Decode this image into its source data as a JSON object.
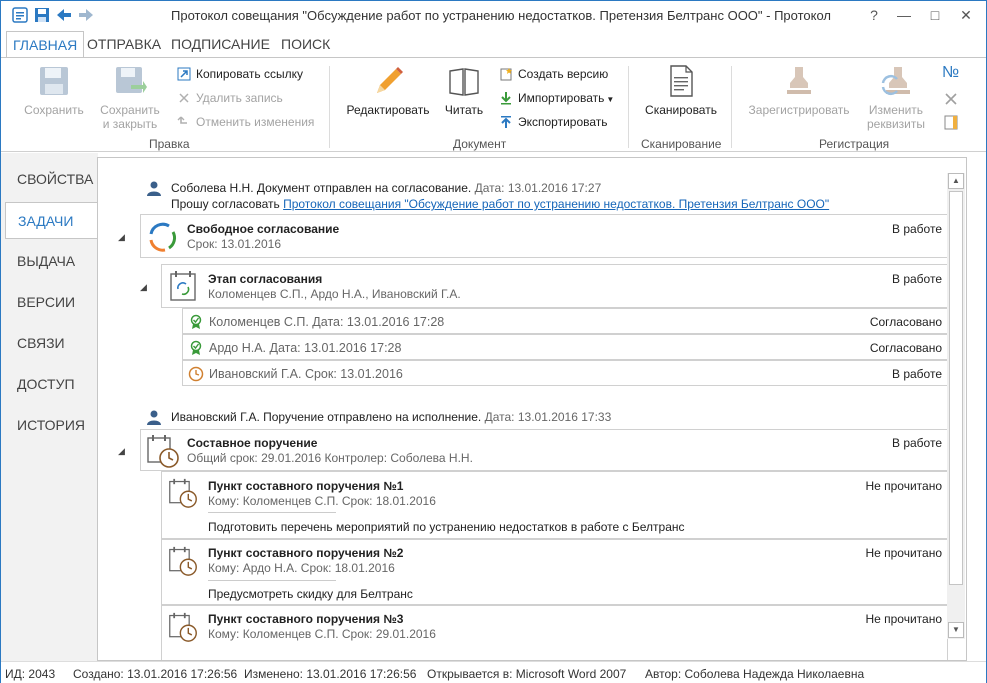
{
  "window": {
    "title": "Протокол совещания \"Обсуждение работ по устранению недостатков. Претензия Белтранс ООО\" - Протокол",
    "help": "?",
    "minimize": "—",
    "maximize": "□",
    "close": "✕"
  },
  "tabs": [
    "ГЛАВНАЯ",
    "ОТПРАВКА",
    "ПОДПИСАНИЕ",
    "ПОИСК"
  ],
  "ribbon": {
    "pravka": {
      "title": "Правка",
      "save": "Сохранить",
      "save_close_1": "Сохранить",
      "save_close_2": "и закрыть",
      "copy_link": "Копировать ссылку",
      "delete": "Удалить запись",
      "undo": "Отменить изменения"
    },
    "document": {
      "title": "Документ",
      "edit": "Редактировать",
      "read": "Читать",
      "create_version": "Создать версию",
      "import": "Импортировать",
      "export": "Экспортировать"
    },
    "scan": {
      "title": "Сканирование",
      "scan": "Сканировать"
    },
    "registration": {
      "title": "Регистрация",
      "register": "Зарегистрировать",
      "change_1": "Изменить",
      "change_2": "реквизиты",
      "number": "№"
    }
  },
  "sidebar": [
    "СВОЙСТВА",
    "ЗАДАЧИ",
    "ВЫДАЧА",
    "ВЕРСИИ",
    "СВЯЗИ",
    "ДОСТУП",
    "ИСТОРИЯ"
  ],
  "content": {
    "msg1": {
      "author": "Соболева Н.Н. Документ отправлен на согласование.",
      "date": "Дата: 13.01.2016 17:27",
      "ask": "Прошу согласовать",
      "link": "Протокол совещания \"Обсуждение работ по устранению недостатков. Претензия Белтранс ООО\""
    },
    "task1": {
      "title": "Свободное согласование",
      "deadline": "Срок: 13.01.2016",
      "status": "В работе"
    },
    "stage": {
      "title": "Этап согласования",
      "members": "Коломенцев С.П., Ардо Н.А., Ивановский Г.А.",
      "status": "В работе"
    },
    "approvals": [
      {
        "text": "Коломенцев С.П. Дата: 13.01.2016 17:28",
        "status": "Согласовано"
      },
      {
        "text": "Ардо Н.А. Дата: 13.01.2016 17:28",
        "status": "Согласовано"
      },
      {
        "text": "Ивановский Г.А. Срок: 13.01.2016",
        "status": "В работе"
      }
    ],
    "msg2": {
      "author": "Ивановский Г.А. Поручение отправлено на исполнение.",
      "date": "Дата: 13.01.2016 17:33"
    },
    "task2": {
      "title": "Составное поручение",
      "details": "Общий срок: 29.01.2016 Контролер: Соболева Н.Н.",
      "status": "В работе"
    },
    "items": [
      {
        "title": "Пункт составного поручения №1",
        "to": "Кому: Коломенцев С.П. Срок: 18.01.2016",
        "desc": "Подготовить перечень мероприятий по устранению недостатков в работе с Белтранс",
        "status": "Не прочитано"
      },
      {
        "title": "Пункт составного поручения №2",
        "to": "Кому: Ардо Н.А. Срок: 18.01.2016",
        "desc": "Предусмотреть скидку для Белтранс",
        "status": "Не прочитано"
      },
      {
        "title": "Пункт составного поручения №3",
        "to": "Кому: Коломенцев С.П. Срок: 29.01.2016",
        "desc": "",
        "status": "Не прочитано"
      }
    ]
  },
  "statusbar": {
    "id": "ИД: 2043",
    "created": "Создано: 13.01.2016 17:26:56",
    "modified": "Изменено: 13.01.2016 17:26:56",
    "opens": "Открывается в: Microsoft Word 2007",
    "author": "Автор: Соболева Надежда Николаевна"
  }
}
